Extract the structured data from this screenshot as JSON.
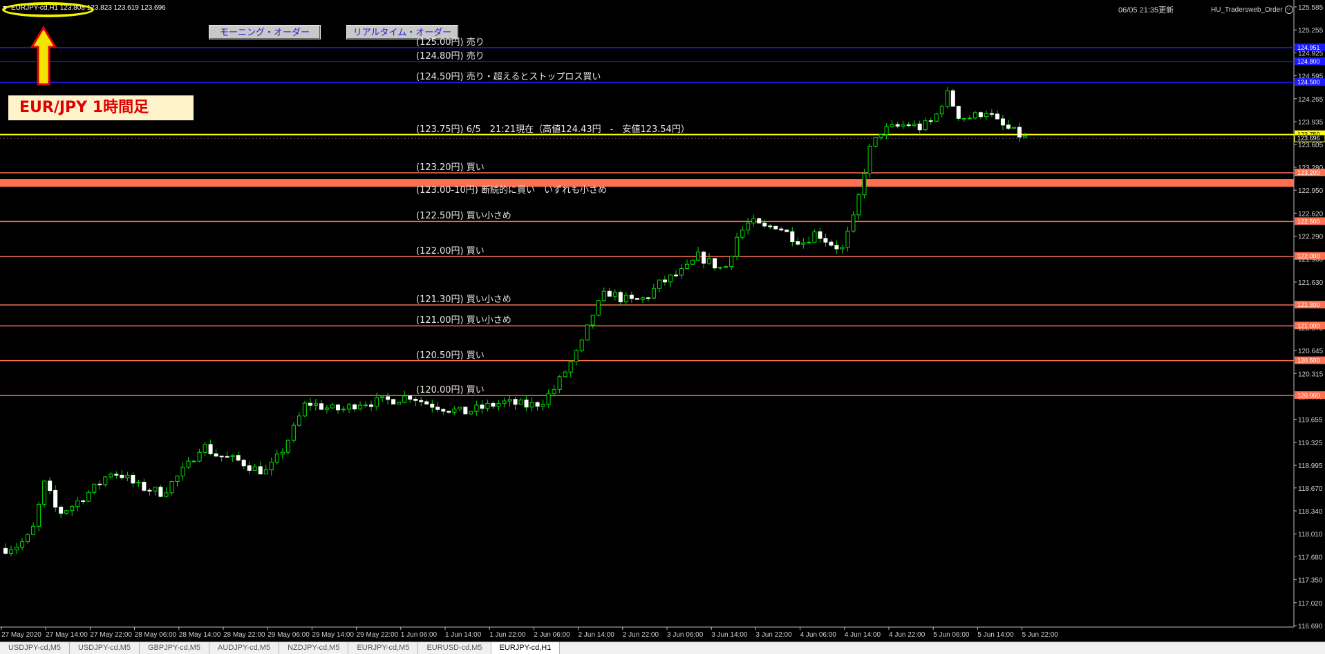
{
  "header": {
    "symbol_label": "EURJPY-cd,H1  123.808 123.823 123.619 123.696",
    "updated": "06/05 21:35更新",
    "ea_name": "HU_Tradersweb_Order"
  },
  "buttons": {
    "morning_order": "モーニング・オーダー",
    "realtime_order": "リアルタイム・オーダー"
  },
  "caption": "EUR/JPY 1時間足",
  "colors": {
    "background": "#000000",
    "bull_candle": "#00e000",
    "bear_candle": "#ffffff",
    "blue_level": "#1a1aff",
    "current_level": "#ffff00",
    "order_level": "#ff7050",
    "annotation": "#ffff00"
  },
  "levels": [
    {
      "price": 125.0,
      "text": "(125.00円) 売り",
      "color": "blue",
      "tag": "124.951"
    },
    {
      "price": 124.8,
      "text": "(124.80円) 売り",
      "color": "blue",
      "tag": "124.800"
    },
    {
      "price": 124.5,
      "text": "(124.50円) 売り・超えるとストップロス買い",
      "color": "blue",
      "tag": "124.500"
    },
    {
      "price": 123.75,
      "text": "(123.75円) 6/5　21:21現在（高値124.43円　-　安値123.54円）",
      "color": "yellow",
      "tag": "123.750"
    },
    {
      "price": 123.2,
      "text": "(123.20円) 買い",
      "color": "orange",
      "tag": "123.200"
    },
    {
      "price": 123.05,
      "text": "(123.00-10円) 断続的に買い　いずれも小さめ",
      "color": "band",
      "tag": ""
    },
    {
      "price": 122.5,
      "text": "(122.50円) 買い小さめ",
      "color": "orange",
      "tag": "122.500"
    },
    {
      "price": 122.0,
      "text": "(122.00円) 買い",
      "color": "orange",
      "tag": "122.000"
    },
    {
      "price": 121.3,
      "text": "(121.30円) 買い小さめ",
      "color": "orange",
      "tag": "121.300"
    },
    {
      "price": 121.0,
      "text": "(121.00円) 買い小さめ",
      "color": "orange",
      "tag": "121.000"
    },
    {
      "price": 120.5,
      "text": "(120.50円) 買い",
      "color": "orange",
      "tag": "120.500"
    },
    {
      "price": 120.0,
      "text": "(120.00円) 買い",
      "color": "orange",
      "tag": "120.000"
    }
  ],
  "current_price": {
    "value": 123.696,
    "tag": "123.696"
  },
  "price_axis": {
    "labels": [
      "125.585",
      "125.255",
      "124.925",
      "124.595",
      "124.265",
      "123.935",
      "123.605",
      "123.280",
      "122.950",
      "122.620",
      "122.290",
      "121.960",
      "121.630",
      "121.300",
      "120.975",
      "120.645",
      "120.315",
      "119.985",
      "119.655",
      "119.325",
      "118.995",
      "118.670",
      "118.340",
      "118.010",
      "117.680",
      "117.350",
      "117.020",
      "116.690"
    ]
  },
  "time_axis": {
    "labels": [
      "27 May 2020",
      "27 May 14:00",
      "27 May 22:00",
      "28 May 06:00",
      "28 May 14:00",
      "28 May 22:00",
      "29 May 06:00",
      "29 May 14:00",
      "29 May 22:00",
      "1 Jun 06:00",
      "1 Jun 14:00",
      "1 Jun 22:00",
      "2 Jun 06:00",
      "2 Jun 14:00",
      "2 Jun 22:00",
      "3 Jun 06:00",
      "3 Jun 14:00",
      "3 Jun 22:00",
      "4 Jun 06:00",
      "4 Jun 14:00",
      "4 Jun 22:00",
      "5 Jun 06:00",
      "5 Jun 14:00",
      "5 Jun 22:00"
    ]
  },
  "chart_data": {
    "type": "candlestick",
    "symbol": "EURJPY-cd",
    "timeframe": "H1",
    "close_path": [
      117.8,
      117.85,
      118.0,
      118.75,
      118.3,
      118.4,
      118.55,
      118.7,
      118.9,
      118.85,
      118.7,
      118.65,
      118.6,
      118.8,
      119.0,
      119.3,
      119.15,
      119.1,
      119.05,
      118.95,
      118.9,
      119.15,
      119.5,
      119.9,
      119.85,
      119.8,
      119.8,
      119.9,
      119.9,
      119.92,
      119.95,
      120.0,
      119.9,
      119.85,
      119.8,
      119.75,
      119.8,
      119.85,
      119.9,
      119.88,
      119.85,
      119.9,
      120.1,
      120.4,
      120.7,
      121.2,
      121.5,
      121.4,
      121.35,
      121.4,
      121.6,
      121.7,
      121.8,
      122.0,
      121.9,
      121.8,
      122.3,
      122.5,
      122.4,
      122.45,
      122.3,
      122.2,
      122.35,
      122.2,
      122.1,
      122.6,
      123.5,
      123.8,
      123.85,
      123.9,
      123.85,
      123.95,
      124.35,
      124.0,
      124.0,
      124.1,
      123.9,
      123.8,
      123.7
    ],
    "high": 124.43,
    "low": 123.54,
    "ylim": [
      116.69,
      125.585
    ]
  },
  "tabs": [
    "USDJPY-cd,M5",
    "USDJPY-cd,M5",
    "GBPJPY-cd,M5",
    "AUDJPY-cd,M5",
    "NZDJPY-cd,M5",
    "EURJPY-cd,M5",
    "EURUSD-cd,M5",
    "EURJPY-cd,H1"
  ],
  "active_tab": 7
}
